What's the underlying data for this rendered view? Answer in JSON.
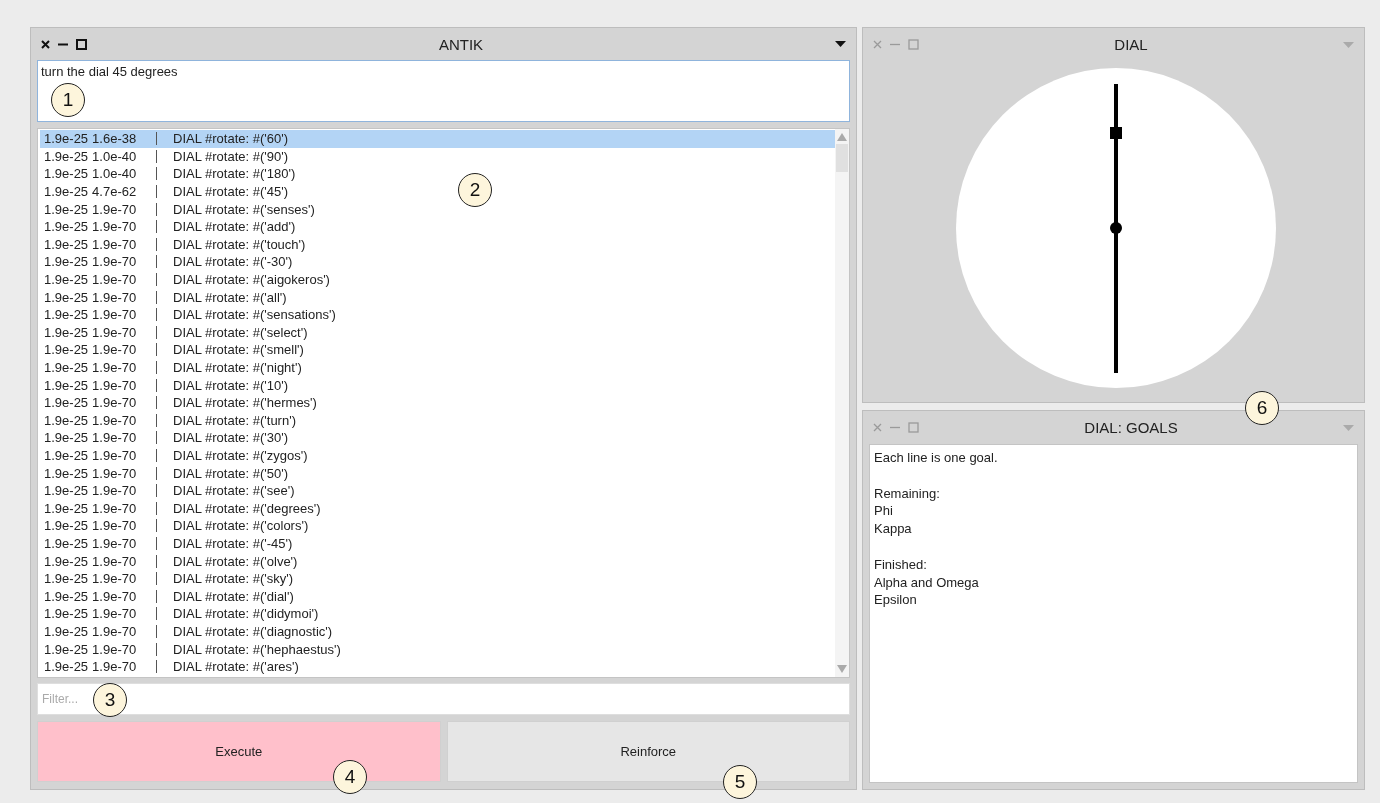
{
  "antik_window": {
    "title": "ANTIK",
    "active": true,
    "input": {
      "value": "turn the dial 45 degrees"
    },
    "results": [
      {
        "score_1": "1.9e-25",
        "score_2": "1.6e-38",
        "command": "DIAL #rotate: #('60')",
        "selected": true
      },
      {
        "score_1": "1.9e-25",
        "score_2": "1.0e-40",
        "command": "DIAL #rotate: #('90')",
        "selected": false
      },
      {
        "score_1": "1.9e-25",
        "score_2": "1.0e-40",
        "command": "DIAL #rotate: #('180')",
        "selected": false
      },
      {
        "score_1": "1.9e-25",
        "score_2": "4.7e-62",
        "command": "DIAL #rotate: #('45')",
        "selected": false
      },
      {
        "score_1": "1.9e-25",
        "score_2": "1.9e-70",
        "command": "DIAL #rotate: #('senses')",
        "selected": false
      },
      {
        "score_1": "1.9e-25",
        "score_2": "1.9e-70",
        "command": "DIAL #rotate: #('add')",
        "selected": false
      },
      {
        "score_1": "1.9e-25",
        "score_2": "1.9e-70",
        "command": "DIAL #rotate: #('touch')",
        "selected": false
      },
      {
        "score_1": "1.9e-25",
        "score_2": "1.9e-70",
        "command": "DIAL #rotate: #('-30')",
        "selected": false
      },
      {
        "score_1": "1.9e-25",
        "score_2": "1.9e-70",
        "command": "DIAL #rotate: #('aigokeros')",
        "selected": false
      },
      {
        "score_1": "1.9e-25",
        "score_2": "1.9e-70",
        "command": "DIAL #rotate: #('all')",
        "selected": false
      },
      {
        "score_1": "1.9e-25",
        "score_2": "1.9e-70",
        "command": "DIAL #rotate: #('sensations')",
        "selected": false
      },
      {
        "score_1": "1.9e-25",
        "score_2": "1.9e-70",
        "command": "DIAL #rotate: #('select')",
        "selected": false
      },
      {
        "score_1": "1.9e-25",
        "score_2": "1.9e-70",
        "command": "DIAL #rotate: #('smell')",
        "selected": false
      },
      {
        "score_1": "1.9e-25",
        "score_2": "1.9e-70",
        "command": "DIAL #rotate: #('night')",
        "selected": false
      },
      {
        "score_1": "1.9e-25",
        "score_2": "1.9e-70",
        "command": "DIAL #rotate: #('10')",
        "selected": false
      },
      {
        "score_1": "1.9e-25",
        "score_2": "1.9e-70",
        "command": "DIAL #rotate: #('hermes')",
        "selected": false
      },
      {
        "score_1": "1.9e-25",
        "score_2": "1.9e-70",
        "command": "DIAL #rotate: #('turn')",
        "selected": false
      },
      {
        "score_1": "1.9e-25",
        "score_2": "1.9e-70",
        "command": "DIAL #rotate: #('30')",
        "selected": false
      },
      {
        "score_1": "1.9e-25",
        "score_2": "1.9e-70",
        "command": "DIAL #rotate: #('zygos')",
        "selected": false
      },
      {
        "score_1": "1.9e-25",
        "score_2": "1.9e-70",
        "command": "DIAL #rotate: #('50')",
        "selected": false
      },
      {
        "score_1": "1.9e-25",
        "score_2": "1.9e-70",
        "command": "DIAL #rotate: #('see')",
        "selected": false
      },
      {
        "score_1": "1.9e-25",
        "score_2": "1.9e-70",
        "command": "DIAL #rotate: #('degrees')",
        "selected": false
      },
      {
        "score_1": "1.9e-25",
        "score_2": "1.9e-70",
        "command": "DIAL #rotate: #('colors')",
        "selected": false
      },
      {
        "score_1": "1.9e-25",
        "score_2": "1.9e-70",
        "command": "DIAL #rotate: #('-45')",
        "selected": false
      },
      {
        "score_1": "1.9e-25",
        "score_2": "1.9e-70",
        "command": "DIAL #rotate: #('olve')",
        "selected": false
      },
      {
        "score_1": "1.9e-25",
        "score_2": "1.9e-70",
        "command": "DIAL #rotate: #('sky')",
        "selected": false
      },
      {
        "score_1": "1.9e-25",
        "score_2": "1.9e-70",
        "command": "DIAL #rotate: #('dial')",
        "selected": false
      },
      {
        "score_1": "1.9e-25",
        "score_2": "1.9e-70",
        "command": "DIAL #rotate: #('didymoi')",
        "selected": false
      },
      {
        "score_1": "1.9e-25",
        "score_2": "1.9e-70",
        "command": "DIAL #rotate: #('diagnostic')",
        "selected": false
      },
      {
        "score_1": "1.9e-25",
        "score_2": "1.9e-70",
        "command": "DIAL #rotate: #('hephaestus')",
        "selected": false
      },
      {
        "score_1": "1.9e-25",
        "score_2": "1.9e-70",
        "command": "DIAL #rotate: #('ares')",
        "selected": false
      }
    ],
    "filter": {
      "placeholder": "Filter..."
    },
    "buttons": [
      {
        "label": "Execute",
        "color": "#ffc0cb"
      },
      {
        "label": "Reinforce",
        "color": "#e6e6e6"
      }
    ]
  },
  "dial_window": {
    "title": "DIAL",
    "active": false
  },
  "goals_window": {
    "title": "DIAL: GOALS",
    "active": false,
    "intro": "Each line is one goal.",
    "sections": [
      {
        "heading": "Remaining:",
        "items": [
          "Phi",
          "Kappa"
        ]
      },
      {
        "heading": "Finished:",
        "items": [
          "Alpha and Omega",
          "Epsilon"
        ]
      }
    ]
  },
  "callouts": [
    "1",
    "2",
    "3",
    "4",
    "5",
    "6"
  ]
}
